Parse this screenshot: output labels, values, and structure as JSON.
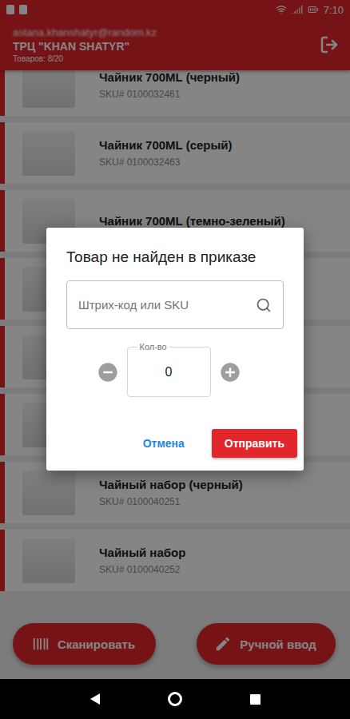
{
  "status_bar": {
    "time": "7:10"
  },
  "header": {
    "email": "astana.khanshatyr@random.kz",
    "title": "ТРЦ \"KHAN SHATYR\"",
    "count": "Товаров: 8/20"
  },
  "items": [
    {
      "title": "Чайник 700ML (черный)",
      "sku": "SKU# 0100032461"
    },
    {
      "title": "Чайник 700ML (серый)",
      "sku": "SKU# 0100032463"
    },
    {
      "title": "Чайник 700ML (темно-зеленый)"
    },
    {},
    {},
    {},
    {
      "title": "Чайный набор (черный)",
      "sku": "SKU# 0100040251"
    },
    {
      "title": "Чайный набор",
      "sku": "SKU# 0100040252"
    }
  ],
  "actions": [
    {
      "label": "Сканировать",
      "kind": "scan"
    },
    {
      "label": "Ручной ввод",
      "kind": "manual"
    }
  ],
  "dialog": {
    "title": "Товар не найден в приказе",
    "search_placeholder": "Штрих-код или SKU",
    "quantity_label": "Кол-во",
    "quantity": "0",
    "buttons": [
      {
        "label": "Отмена",
        "kind": "text"
      },
      {
        "label": "Отправить",
        "kind": "filled"
      }
    ]
  }
}
